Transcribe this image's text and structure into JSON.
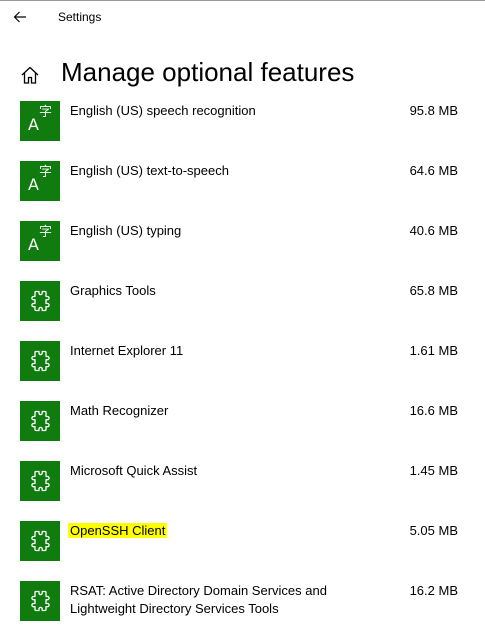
{
  "window": {
    "title": "Settings"
  },
  "header": {
    "title": "Manage optional features"
  },
  "colors": {
    "accent": "#107c10",
    "highlight": "#ffff00"
  },
  "features": [
    {
      "name": "English (US) speech recognition",
      "size": "95.8 MB",
      "icon": "language-icon"
    },
    {
      "name": "English (US) text-to-speech",
      "size": "64.6 MB",
      "icon": "language-icon"
    },
    {
      "name": "English (US) typing",
      "size": "40.6 MB",
      "icon": "language-icon"
    },
    {
      "name": "Graphics Tools",
      "size": "65.8 MB",
      "icon": "puzzle-icon"
    },
    {
      "name": "Internet Explorer 11",
      "size": "1.61 MB",
      "icon": "puzzle-icon"
    },
    {
      "name": "Math Recognizer",
      "size": "16.6 MB",
      "icon": "puzzle-icon"
    },
    {
      "name": "Microsoft Quick Assist",
      "size": "1.45 MB",
      "icon": "puzzle-icon"
    },
    {
      "name": "OpenSSH Client",
      "size": "5.05 MB",
      "icon": "puzzle-icon",
      "highlighted": true
    },
    {
      "name": "RSAT: Active Directory Domain Services and Lightweight Directory Services Tools",
      "size": "16.2 MB",
      "icon": "puzzle-icon"
    }
  ]
}
